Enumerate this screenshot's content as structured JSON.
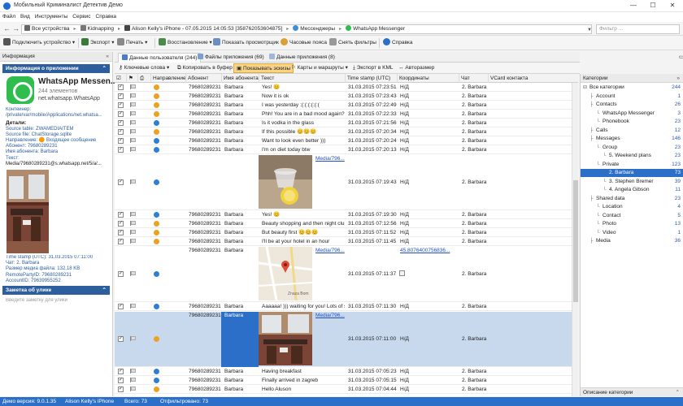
{
  "window": {
    "title": "Мобильный Криминалист Детектив Демо",
    "buttons": [
      "—",
      "☐",
      "✕"
    ]
  },
  "menu": [
    "Файл",
    "Вид",
    "Инструменты",
    "Сервис",
    "Справка"
  ],
  "breadcrumbs": [
    "Все устройства",
    "Kidnapping",
    "Alison Kelly's iPhone - 07.05.2015 14:05:53 [358762053604875]",
    "Мессенджеры",
    "WhatsApp Messenger"
  ],
  "filter_placeholder": "Фильтр ...",
  "toolbar": {
    "connect": "Подключить устройство",
    "export": "Экспорт",
    "print": "Печать",
    "restore": "Восстановление",
    "show_viewed": "Показать просмотрщик",
    "timezones": "Часовые пояса",
    "clear_filters": "Снять фильтры",
    "help": "Справка"
  },
  "left": {
    "header": "Информация",
    "app_section": "Информация о приложении",
    "app_name": "WhatsApp Messen...",
    "app_count": "244 элементов",
    "app_package": "net.whatsapp.WhatsApp",
    "container_label": "Контейнер:",
    "container_value": "/private/var/mobile/Applications/net.whatsa...",
    "details": "Детали:",
    "source_table": "Source table: ZWAMEDIAITEM",
    "source_file": "Source file: ChatStorage.sqlite",
    "direction": "Направление: 🟠 Входящее сообщение",
    "subscriber": "Абонент: 79680289231",
    "subscriber_name": "Имя абонента: Barbara",
    "text_label": "Текст:",
    "text_value": "Media/79680289231@s.whatsapp.net/5/a/...",
    "timestamp": "Time stamp (UTC): 31.03.2015 07:11:00",
    "chat": "Чат: 2. Barbara",
    "media_size": "Размер медиа файла: 132,18 KB",
    "remote_party": "RemotePartyID: 79680289231",
    "account": "AccountID: 79639955252",
    "note_section": "Заметка об улике",
    "note_placeholder": "Введите заметку для улики"
  },
  "tabs": [
    "Данные пользователя (244)",
    "Файлы приложения (69)",
    "Данные приложения (8)"
  ],
  "subtoolbar": [
    "Ключевые слова",
    "Копировать в буфер",
    "Показывать эскизы",
    "Карты и маршруты",
    "Экспорт в KML",
    "Авторазмер"
  ],
  "columns": [
    "Направление",
    "Абонент",
    "Имя абонента",
    "Текст",
    "Time stamp (UTC)",
    "Координаты",
    "Чат",
    "VCard контакта"
  ],
  "rows": [
    {
      "dir": "in",
      "num": "79680289231",
      "name": "Barbara",
      "text": "Yes! 😊",
      "ts": "31.03.2015 07:23:51",
      "coord": "Н/Д",
      "chat": "2. Barbara"
    },
    {
      "dir": "in",
      "num": "79680289231",
      "name": "Barbara",
      "text": "Now it is ok",
      "ts": "31.03.2015 07:23:43",
      "coord": "Н/Д",
      "chat": "2. Barbara"
    },
    {
      "dir": "in",
      "num": "79680289231",
      "name": "Barbara",
      "text": "I was yesterday :(:(:(:(:(:(",
      "ts": "31.03.2015 07:22:49",
      "coord": "Н/Д",
      "chat": "2. Barbara"
    },
    {
      "dir": "in",
      "num": "79680289231",
      "name": "Barbara",
      "text": "Phh! You are in a bad mood again?",
      "ts": "31.03.2015 07:22:33",
      "coord": "Н/Д",
      "chat": "2. Barbara"
    },
    {
      "dir": "out",
      "num": "79680289231",
      "name": "Barbara",
      "text": "Is it vodka in the glass",
      "ts": "31.03.2015 07:21:56",
      "coord": "Н/Д",
      "chat": "2. Barbara"
    },
    {
      "dir": "in",
      "num": "79680289231",
      "name": "Barbara",
      "text": "If this possible 😊😊😊",
      "ts": "31.03.2015 07:20:34",
      "coord": "Н/Д",
      "chat": "2. Barbara"
    },
    {
      "dir": "out",
      "num": "79680289231",
      "name": "Barbara",
      "text": "Want to look even better )))",
      "ts": "31.03.2015 07:20:24",
      "coord": "Н/Д",
      "chat": "2. Barbara"
    },
    {
      "dir": "out",
      "num": "79680289231",
      "name": "Barbara",
      "text": "I'm on diet today btw",
      "ts": "31.03.2015 07:20:13",
      "coord": "Н/Д",
      "chat": "2. Barbara"
    },
    {
      "dir": "out",
      "num": "",
      "name": "",
      "text": "",
      "media": "Media/796...",
      "thumb": "glass",
      "ts": "31.03.2015 07:19:43",
      "coord": "Н/Д",
      "chat": "2. Barbara"
    },
    {
      "dir": "out",
      "num": "79680289231",
      "name": "Barbara",
      "text": "Yes! 😊",
      "ts": "31.03.2015 07:19:30",
      "coord": "Н/Д",
      "chat": "2. Barbara"
    },
    {
      "dir": "in",
      "num": "79680289231",
      "name": "Barbara",
      "text": "Beauty shopping and then night club",
      "ts": "31.03.2015 07:12:56",
      "coord": "Н/Д",
      "chat": "2. Barbara"
    },
    {
      "dir": "in",
      "num": "79680289231",
      "name": "Barbara",
      "text": "But beauty first 😊😊😊",
      "ts": "31.03.2015 07:11:52",
      "coord": "Н/Д",
      "chat": "2. Barbara"
    },
    {
      "dir": "in",
      "num": "79680289231",
      "name": "Barbara",
      "text": "I'll be at your hotel in an hour",
      "ts": "31.03.2015 07:11:45",
      "coord": "Н/Д",
      "chat": "2. Barbara"
    },
    {
      "dir": "out",
      "num": "79680289231",
      "name": "Barbara",
      "text": "",
      "media": "Media/796...",
      "thumb": "map",
      "map_label": "Znaza Bom",
      "ts": "31.03.2015 07:11:37",
      "coord": "45.8076400756836...",
      "chat": "2. Barbara"
    },
    {
      "dir": "out",
      "num": "79680289231",
      "name": "Barbara",
      "text": "Aaaaaa! ))) waiting for you! Lots of s...",
      "ts": "31.03.2015 07:11:30",
      "coord": "Н/Д",
      "chat": "2. Barbara"
    },
    {
      "dir": "in",
      "num": "79680289231",
      "name": "Barbara",
      "text": "",
      "media": "Media/796...",
      "thumb": "room",
      "ts": "31.03.2015 07:11:00",
      "coord": "Н/Д",
      "chat": "2. Barbara",
      "selected": true
    },
    {
      "dir": "out",
      "num": "79680289231",
      "name": "Barbara",
      "text": "Having breakfast",
      "ts": "31.03.2015 07:05:23",
      "coord": "Н/Д",
      "chat": "2. Barbara"
    },
    {
      "dir": "out",
      "num": "79680289231",
      "name": "Barbara",
      "text": "Finally arrived in zagreb",
      "ts": "31.03.2015 07:05:15",
      "coord": "Н/Д",
      "chat": "2. Barbara"
    },
    {
      "dir": "in",
      "num": "79680289231",
      "name": "Barbara",
      "text": "Hello Aluson",
      "ts": "31.03.2015 07:04:44",
      "coord": "Н/Д",
      "chat": "2. Barbara"
    }
  ],
  "categories_header": "Категории",
  "categories": [
    {
      "name": "Все категории",
      "count": "244",
      "indent": 0
    },
    {
      "name": "Account",
      "count": "1",
      "indent": 1
    },
    {
      "name": "Contacts",
      "count": "26",
      "indent": 1
    },
    {
      "name": "WhatsApp Messenger",
      "count": "3",
      "indent": 2
    },
    {
      "name": "Phonebook",
      "count": "23",
      "indent": 2
    },
    {
      "name": "Calls",
      "count": "12",
      "indent": 1
    },
    {
      "name": "Messages",
      "count": "146",
      "indent": 1
    },
    {
      "name": "Group",
      "count": "23",
      "indent": 2
    },
    {
      "name": "5. Weekend plans",
      "count": "23",
      "indent": 3
    },
    {
      "name": "Private",
      "count": "123",
      "indent": 2
    },
    {
      "name": "2. Barbara",
      "count": "73",
      "indent": 3,
      "selected": true
    },
    {
      "name": "3. Stephen Bremer",
      "count": "39",
      "indent": 3
    },
    {
      "name": "4. Angela Gibson",
      "count": "11",
      "indent": 3
    },
    {
      "name": "Shared data",
      "count": "23",
      "indent": 1
    },
    {
      "name": "Location",
      "count": "4",
      "indent": 2
    },
    {
      "name": "Contact",
      "count": "5",
      "indent": 2
    },
    {
      "name": "Photo",
      "count": "13",
      "indent": 2
    },
    {
      "name": "Video",
      "count": "1",
      "indent": 2
    },
    {
      "name": "Media",
      "count": "36",
      "indent": 1
    }
  ],
  "categories_footer": "Описание категории",
  "status": {
    "version": "Демо версия: 9.0.1.35",
    "device": "Alison Kelly's iPhone",
    "total": "Всего: 73",
    "filtered": "Отфильтровано: 73"
  },
  "colors": {
    "accent": "#2c6fc8",
    "whatsapp": "#2fbd4d",
    "incoming": "#f0a020",
    "outgoing": "#2b7fd6",
    "selected_row": "#c8d9ee"
  }
}
